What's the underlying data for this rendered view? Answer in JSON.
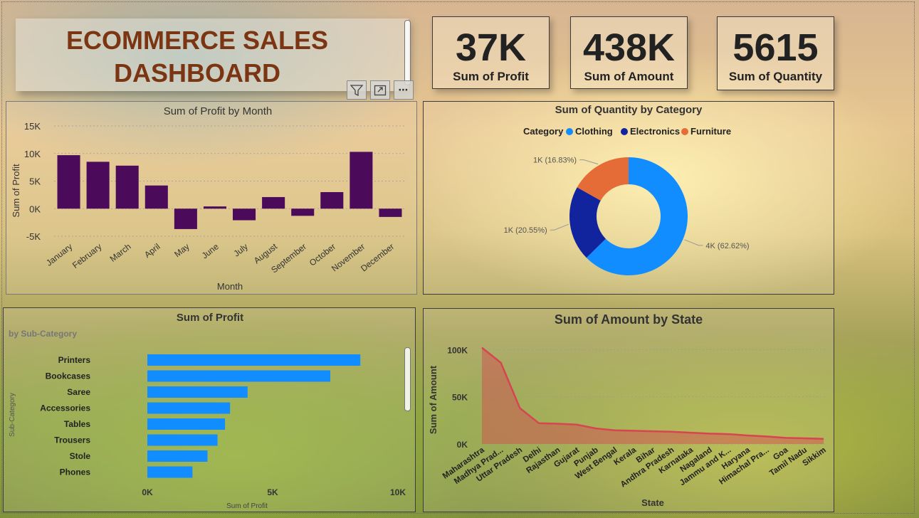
{
  "title": {
    "line1": "ECOMMERCE SALES",
    "line2": "DASHBOARD"
  },
  "kpis": [
    {
      "value": "37K",
      "label": "Sum of Profit"
    },
    {
      "value": "438K",
      "label": "Sum of Amount"
    },
    {
      "value": "5615",
      "label": "Sum of Quantity"
    }
  ],
  "visual_toolbar": {
    "filter_icon": "filter-icon",
    "focus_icon": "focus-mode-icon",
    "more_icon": "more-options-icon"
  },
  "chart_data": [
    {
      "type": "bar",
      "title": "Sum of Profit by Month",
      "xlabel": "Month",
      "ylabel": "Sum of Profit",
      "ylim": [
        -5000,
        15000
      ],
      "yticks": [
        "15K",
        "10K",
        "5K",
        "0K",
        "-5K"
      ],
      "color": "#4b0a5a",
      "categories": [
        "January",
        "February",
        "March",
        "April",
        "May",
        "June",
        "July",
        "August",
        "September",
        "October",
        "November",
        "December"
      ],
      "values": [
        9700,
        8500,
        7800,
        4200,
        -3700,
        400,
        -2100,
        2100,
        -1300,
        3000,
        10300,
        -1500
      ]
    },
    {
      "type": "pie",
      "title": "Sum of Quantity by Category",
      "legend_title": "Category",
      "legend_position": "top",
      "series": [
        {
          "name": "Clothing",
          "value": 62.62,
          "label": "4K (62.62%)",
          "color": "#118dff"
        },
        {
          "name": "Electronics",
          "value": 20.55,
          "label": "1K (20.55%)",
          "color": "#12239e"
        },
        {
          "name": "Furniture",
          "value": 16.83,
          "label": "1K (16.83%)",
          "color": "#e66c37"
        }
      ]
    },
    {
      "type": "bar",
      "orientation": "horizontal",
      "title": "Sum of Profit",
      "subtitle": "by Sub-Category",
      "xlabel": "Sum of Profit",
      "ylabel": "Sub-Category",
      "xlim": [
        0,
        10000
      ],
      "xticks": [
        "0K",
        "5K",
        "10K"
      ],
      "color": "#118dff",
      "categories": [
        "Printers",
        "Bookcases",
        "Saree",
        "Accessories",
        "Tables",
        "Trousers",
        "Stole",
        "Phones"
      ],
      "values": [
        8500,
        7300,
        4000,
        3300,
        3100,
        2800,
        2400,
        1800
      ]
    },
    {
      "type": "area",
      "title": "Sum of Amount by State",
      "xlabel": "State",
      "ylabel": "Sum of Amount",
      "ylim": [
        0,
        110000
      ],
      "yticks": [
        "100K",
        "50K",
        "0K"
      ],
      "color": "#d64550",
      "categories": [
        "Maharashtra",
        "Madhya Prad...",
        "Uttar Pradesh",
        "Delhi",
        "Rajasthan",
        "Gujarat",
        "Punjab",
        "West Bengal",
        "Kerala",
        "Bihar",
        "Andhra Pradesh",
        "Karnataka",
        "Nagaland",
        "Jammu and K...",
        "Haryana",
        "Himachal Pra...",
        "Goa",
        "Tamil Nadu",
        "Sikkim"
      ],
      "values": [
        102000,
        86000,
        38000,
        22000,
        21500,
        20500,
        16500,
        14500,
        14000,
        13500,
        13000,
        12000,
        11000,
        10500,
        9000,
        8000,
        6500,
        6000,
        5500
      ]
    }
  ]
}
